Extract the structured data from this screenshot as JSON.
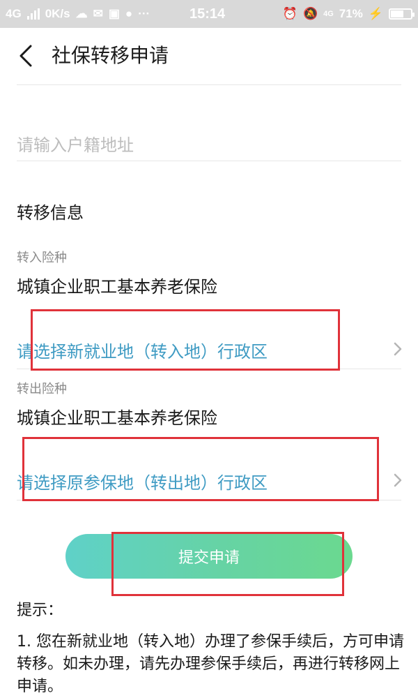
{
  "status_bar": {
    "network": "4G",
    "speed": "0K/s",
    "time": "15:14",
    "mobile_label": "4G",
    "battery_percent": "71%",
    "battery_level": 0.71,
    "dots": "···"
  },
  "header": {
    "title": "社保转移申请"
  },
  "form": {
    "household_address_placeholder": "请输入户籍地址",
    "transfer_info_title": "转移信息",
    "transfer_in_label": "转入险种",
    "transfer_in_value": "城镇企业职工基本养老保险",
    "new_area_select": "请选择新就业地（转入地）行政区",
    "transfer_out_label": "转出险种",
    "transfer_out_value": "城镇企业职工基本养老保险",
    "original_area_select": "请选择原参保地（转出地）行政区"
  },
  "submit_label": "提交申请",
  "tips": {
    "title": "提示：",
    "body": "1. 您在新就业地（转入地）办理了参保手续后，方可申请转移。如未办理，请先办理参保手续后，再进行转移网上申请。"
  },
  "colors": {
    "accent_text": "#3f9bc3",
    "highlight_box": "#e0323a",
    "button_gradient_start": "#5fd1c8",
    "button_gradient_end": "#6bd98f"
  }
}
